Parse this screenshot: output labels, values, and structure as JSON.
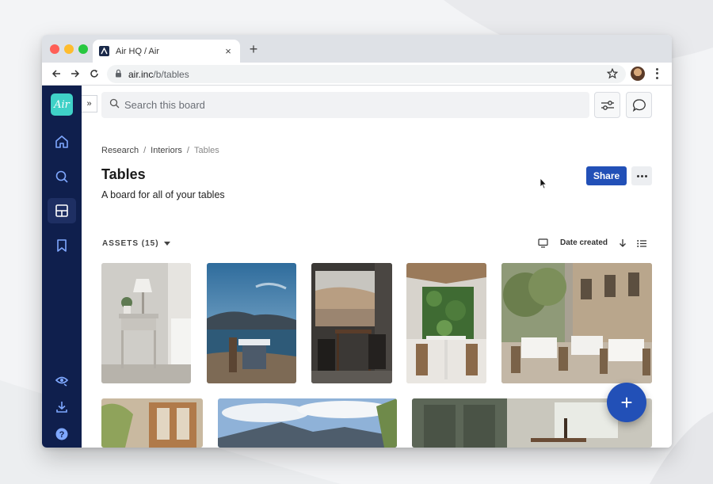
{
  "browser": {
    "tab_title": "Air HQ / Air",
    "tab_close": "×",
    "new_tab": "+",
    "url_host": "air.inc",
    "url_path": "/b/tables"
  },
  "sidebar": {
    "logo_text": "Air",
    "items": [
      {
        "icon": "home-icon"
      },
      {
        "icon": "search-icon"
      },
      {
        "icon": "boards-icon",
        "active": true
      },
      {
        "icon": "bookmark-icon"
      }
    ],
    "bottom_items": [
      {
        "icon": "palette-icon"
      },
      {
        "icon": "download-icon"
      },
      {
        "icon": "help-icon"
      }
    ],
    "expand_label": "»"
  },
  "search": {
    "placeholder": "Search this board"
  },
  "breadcrumb": {
    "items": [
      "Research",
      "Interiors",
      "Tables"
    ],
    "separator": "/"
  },
  "board": {
    "title": "Tables",
    "description": "A board for all of your tables",
    "share_label": "Share"
  },
  "assets": {
    "label": "ASSETS (15)",
    "sort_label": "Date created"
  },
  "colors": {
    "sidebar_bg": "#0f1f4d",
    "accent": "#2250b7",
    "logo": "#3fd1c7"
  },
  "fab_label": "+"
}
